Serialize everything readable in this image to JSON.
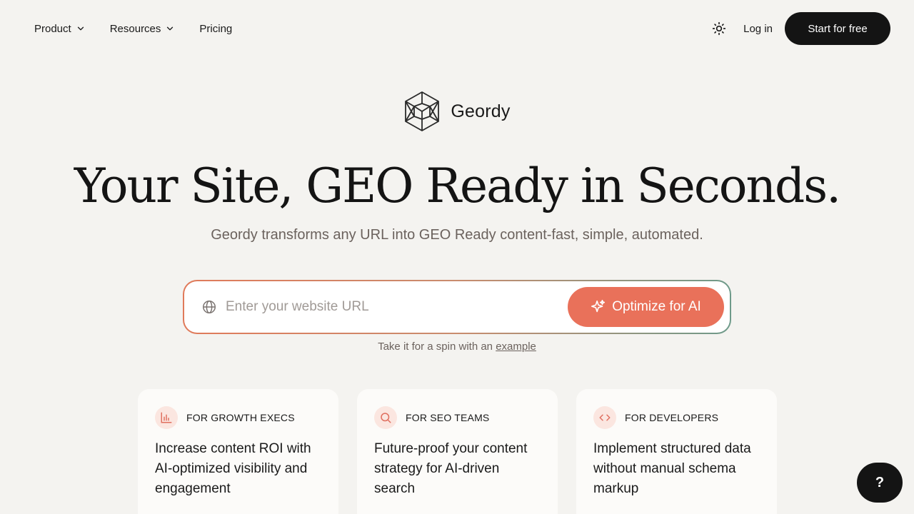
{
  "nav": {
    "items": [
      {
        "label": "Product",
        "has_dropdown": true
      },
      {
        "label": "Resources",
        "has_dropdown": true
      },
      {
        "label": "Pricing",
        "has_dropdown": false
      }
    ],
    "theme_icon": "sun-icon",
    "login_label": "Log in",
    "cta_label": "Start for free"
  },
  "brand": {
    "name": "Geordy",
    "logo_icon": "geordy-logo-icon"
  },
  "hero": {
    "title": "Your Site, GEO Ready in Seconds.",
    "subtitle": "Geordy transforms any URL into GEO Ready content-fast, simple, automated."
  },
  "url_form": {
    "placeholder": "Enter your website URL",
    "value": "",
    "button_label": "Optimize for AI",
    "button_icon": "sparkle-icon",
    "input_icon": "globe-icon"
  },
  "spin": {
    "prefix": "Take it for a spin with an",
    "link": "example"
  },
  "cards": [
    {
      "icon": "bar-chart-icon",
      "label": "FOR GROWTH EXECS",
      "text": "Increase content ROI with AI-optimized visibility and engagement"
    },
    {
      "icon": "search-icon",
      "label": "FOR SEO TEAMS",
      "text": "Future-proof your content strategy for AI-driven search"
    },
    {
      "icon": "code-icon",
      "label": "FOR DEVELOPERS",
      "text": "Implement structured data without manual schema markup"
    }
  ],
  "help": {
    "label": "?"
  },
  "colors": {
    "accent": "#e9715a",
    "dark": "#141414",
    "background": "#f4f3f0",
    "icon_bg": "#fbe6e0"
  }
}
